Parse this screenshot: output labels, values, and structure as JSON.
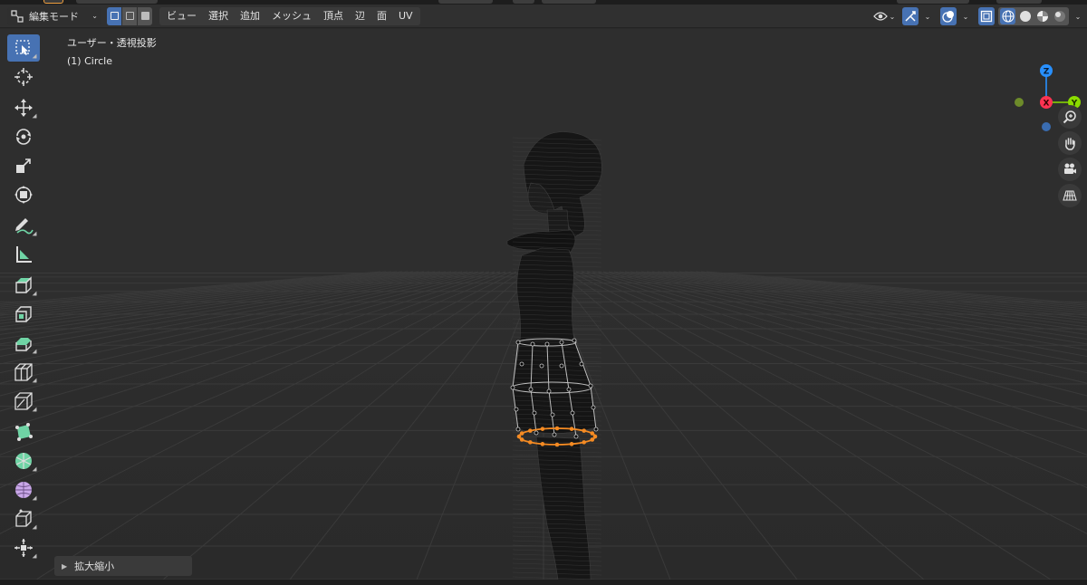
{
  "header": {
    "mode_label": "編集モード",
    "menus": [
      "ビュー",
      "選択",
      "追加",
      "メッシュ",
      "頂点",
      "辺",
      "面",
      "UV"
    ]
  },
  "viewport": {
    "view_name": "ユーザー・透視投影",
    "object_name": "(1) Circle"
  },
  "operator_panel": {
    "label": "拡大縮小"
  },
  "gizmo": {
    "z_label": "Z",
    "x_label": "X",
    "y_label": "Y"
  },
  "colors": {
    "accent": "#4772b3",
    "selection": "#f58b23",
    "axis_x": "#ff3352",
    "axis_y": "#8bdc00",
    "axis_z": "#2890ff"
  },
  "icons": {
    "toolbar": [
      "select-box-icon",
      "cursor-icon",
      "move-icon",
      "rotate-icon",
      "scale-icon",
      "transform-icon",
      "annotate-icon",
      "measure-icon",
      "extrude-region-icon",
      "inset-faces-icon",
      "bevel-icon",
      "loop-cut-icon",
      "knife-icon",
      "poly-build-icon",
      "spin-icon",
      "smooth-icon",
      "edge-slide-icon",
      "shrink-fatten-icon"
    ],
    "navigation": [
      "zoom-icon",
      "pan-hand-icon",
      "camera-icon",
      "grid-perspective-icon"
    ]
  }
}
